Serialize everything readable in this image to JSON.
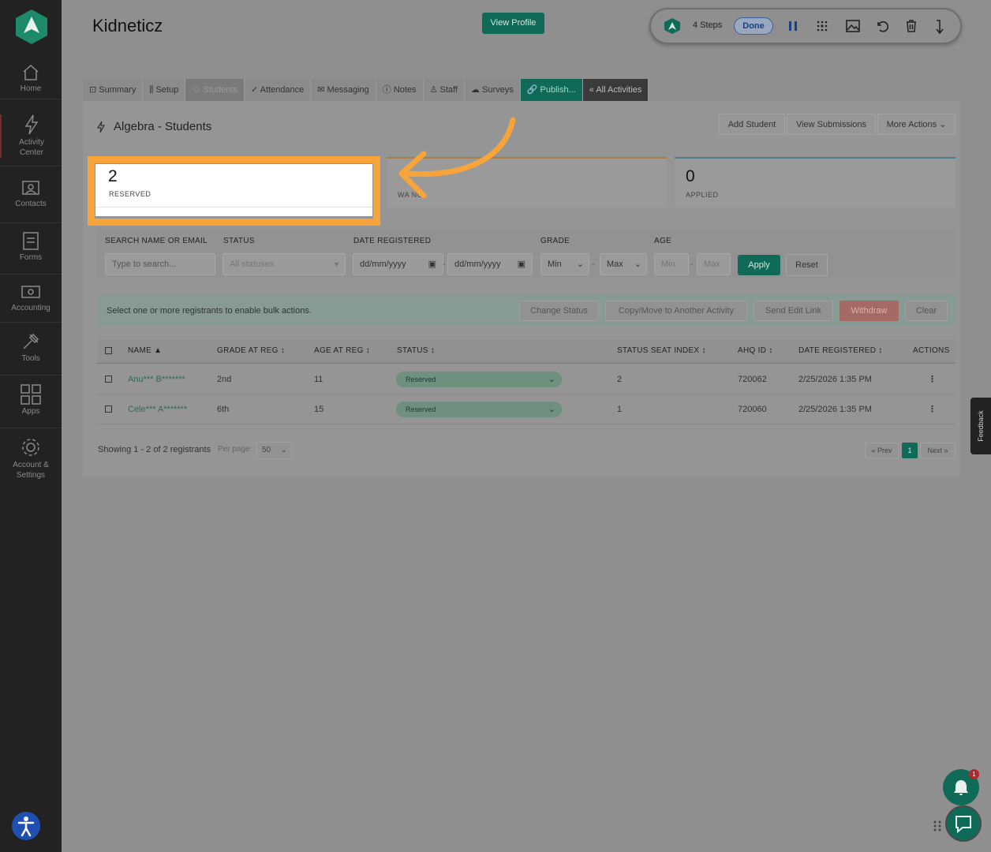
{
  "sidebar": {
    "items": [
      {
        "label": "Home",
        "icon": "home-icon"
      },
      {
        "label": "Activity Center",
        "icon": "lightning-icon"
      },
      {
        "label": "Contacts",
        "icon": "contacts-icon"
      },
      {
        "label": "Forms",
        "icon": "forms-icon"
      },
      {
        "label": "Accounting",
        "icon": "accounting-icon"
      },
      {
        "label": "Tools",
        "icon": "tools-icon"
      },
      {
        "label": "Apps",
        "icon": "apps-icon"
      },
      {
        "label": "Account & Settings",
        "icon": "gear-icon"
      }
    ]
  },
  "header": {
    "title": "Kidneticz",
    "view_profile": "View Profile"
  },
  "stepbar": {
    "steps_label": "4 Steps",
    "done_label": "Done"
  },
  "tabs": [
    "Summary",
    "Setup",
    "Students",
    "Attendance",
    "Messaging",
    "Notes",
    "Staff",
    "Surveys",
    "Publish...",
    "« All Activities"
  ],
  "section": {
    "title": "Algebra - Students",
    "add_student": "Add Student",
    "view_submissions": "View Submissions",
    "more_actions": "More Actions"
  },
  "stats": [
    {
      "value": "2",
      "label": "RESERVED"
    },
    {
      "value": "",
      "label": "WA    NG"
    },
    {
      "value": "0",
      "label": "APPLIED"
    }
  ],
  "filters": {
    "search_label": "SEARCH NAME OR EMAIL",
    "search_placeholder": "Type to search...",
    "status_label": "STATUS",
    "status_value": "All statuses",
    "date_label": "DATE REGISTERED",
    "date_from": "dd/mm/yyyy",
    "date_to": "dd/mm/yyyy",
    "grade_label": "GRADE",
    "grade_min": "Min",
    "grade_max": "Max",
    "age_label": "AGE",
    "age_min": "Min",
    "age_max": "Max",
    "apply": "Apply",
    "reset": "Reset"
  },
  "bulk": {
    "text": "Select one or more registrants to enable bulk actions.",
    "change_status": "Change Status",
    "copy_move": "Copy/Move to Another Activity",
    "send_edit_link": "Send Edit Link",
    "withdraw": "Withdraw",
    "clear": "Clear"
  },
  "table": {
    "headers": [
      "NAME ▲",
      "GRADE AT REG ↕",
      "AGE AT REG ↕",
      "STATUS ↕",
      "STATUS SEAT INDEX ↕",
      "AHQ ID ↕",
      "DATE REGISTERED ↕",
      "ACTIONS"
    ],
    "rows": [
      {
        "name": "Anu*** B*******",
        "grade": "2nd",
        "age": "11",
        "status": "Reserved",
        "seat": "2",
        "id": "720062",
        "date": "2/25/2026 1:35 PM",
        "actions": "⋮"
      },
      {
        "name": "Cele*** A*******",
        "grade": "6th",
        "age": "15",
        "status": "Reserved",
        "seat": "1",
        "id": "720060",
        "date": "2/25/2026 1:35 PM",
        "actions": "⋮"
      }
    ]
  },
  "footer": {
    "showing": "Showing 1 - 2 of 2 registrants",
    "per_page_label": "Per page:",
    "per_page_value": "50",
    "prev": "« Prev",
    "page": "1",
    "next": "Next »"
  },
  "feedback": "Feedback",
  "notification_count": "1",
  "colors": {
    "brand_green": "#0f6b57",
    "highlight_orange": "#f7a43a",
    "sidebar_bg": "#222222"
  }
}
